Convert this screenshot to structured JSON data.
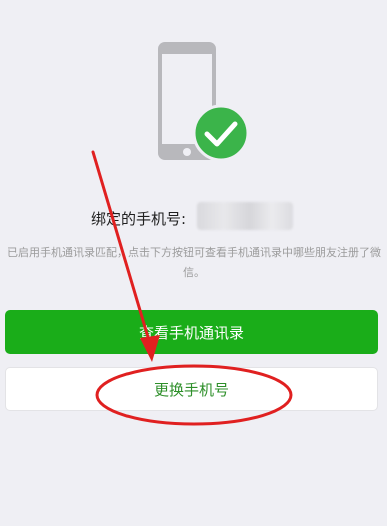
{
  "binding": {
    "label": "绑定的手机号:",
    "description": "已启用手机通讯录匹配，点击下方按钮可查看手机通讯录中哪些朋友注册了微信。"
  },
  "buttons": {
    "view_contacts": "查看手机通讯录",
    "change_phone": "更换手机号"
  },
  "icons": {
    "phone": "phone-icon",
    "check": "checkmark-badge-icon"
  },
  "colors": {
    "primary_green": "#1aad19",
    "badge_green": "#3bb44a",
    "annotation_red": "#e02020"
  }
}
